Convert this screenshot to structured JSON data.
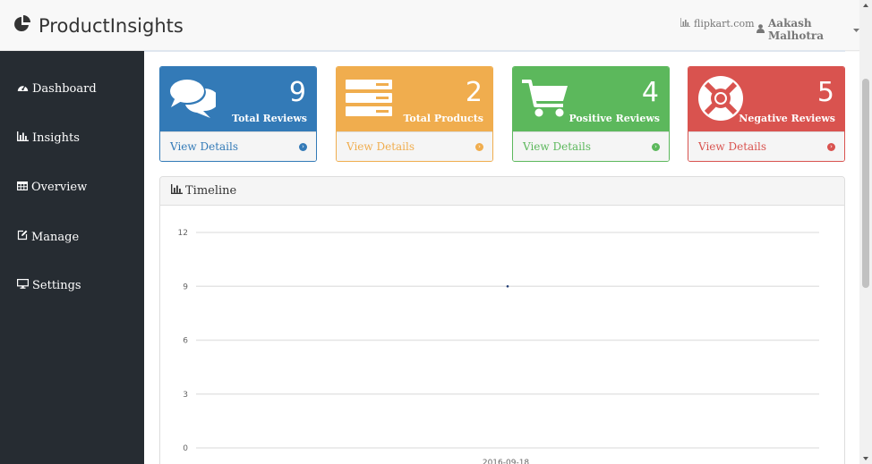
{
  "header": {
    "brand": "ProductInsights",
    "source_link": "flipkart.com",
    "user_name": "Aakash Malhotra"
  },
  "sidebar": {
    "items": [
      {
        "label": "Dashboard",
        "icon": "dashboard-icon"
      },
      {
        "label": "Insights",
        "icon": "bar-chart-icon"
      },
      {
        "label": "Overview",
        "icon": "table-icon"
      },
      {
        "label": "Manage",
        "icon": "edit-icon"
      },
      {
        "label": "Settings",
        "icon": "desktop-icon"
      }
    ]
  },
  "cards": [
    {
      "count": "9",
      "label": "Total Reviews",
      "link": "View Details",
      "color": "#337ab7",
      "icon": "comments-icon"
    },
    {
      "count": "2",
      "label": "Total Products",
      "link": "View Details",
      "color": "#f0ad4e",
      "icon": "server-icon"
    },
    {
      "count": "4",
      "label": "Positive Reviews",
      "link": "View Details",
      "color": "#5cb85c",
      "icon": "shopping-cart-icon"
    },
    {
      "count": "5",
      "label": "Negative Reviews",
      "link": "View Details",
      "color": "#d9534f",
      "icon": "life-ring-icon"
    }
  ],
  "panel": {
    "title": "Timeline"
  },
  "chart_data": {
    "type": "scatter",
    "title": "Timeline",
    "xlabel": "",
    "ylabel": "",
    "ylim": [
      0,
      12
    ],
    "yticks": [
      "12",
      "9",
      "6",
      "3",
      "0"
    ],
    "categories": [
      "2016-09-18"
    ],
    "series": [
      {
        "values": [
          9
        ]
      }
    ],
    "grid": true
  }
}
